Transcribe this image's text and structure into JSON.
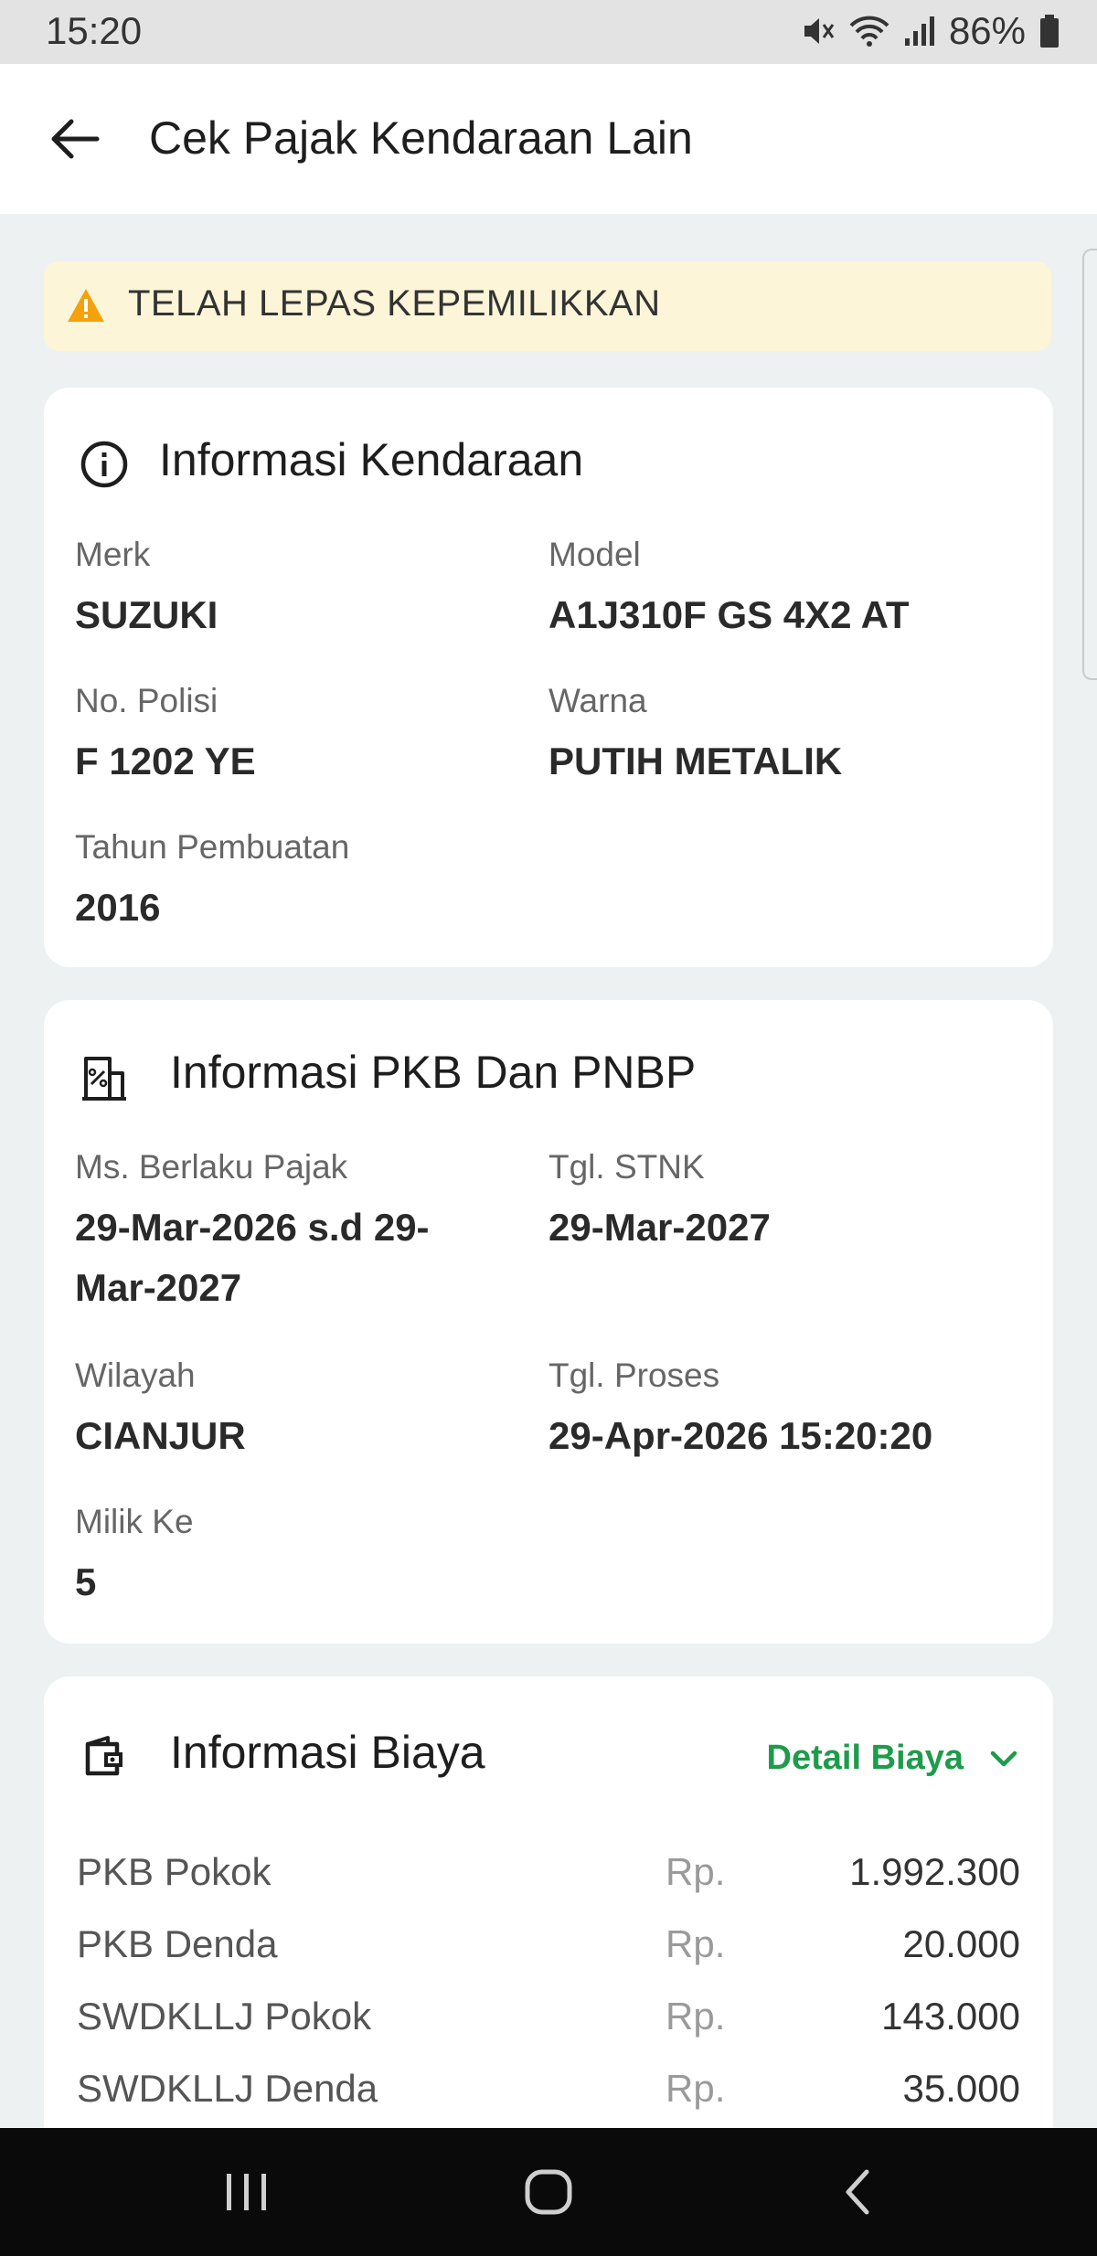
{
  "status_bar": {
    "time": "15:20",
    "battery": "86%"
  },
  "app_bar": {
    "title": "Cek Pajak Kendaraan Lain"
  },
  "alert": {
    "text": "TELAH LEPAS KEPEMILIKKAN",
    "color": "#fdf5d8",
    "icon": "warning-icon"
  },
  "vehicle_card": {
    "title": "Informasi Kendaraan",
    "icon": "info-icon",
    "fields": [
      {
        "label": "Merk",
        "value": "SUZUKI"
      },
      {
        "label": "Model",
        "value": "A1J310F GS 4X2 AT"
      },
      {
        "label": "No. Polisi",
        "value": "F 1202 YE"
      },
      {
        "label": "Warna",
        "value": "PUTIH METALIK"
      },
      {
        "label": "Tahun Pembuatan",
        "value": "2016"
      }
    ]
  },
  "pkb_card": {
    "title": "Informasi PKB Dan PNBP",
    "icon": "tax-building-icon",
    "fields": [
      {
        "label": "Ms. Berlaku Pajak",
        "value_line1": "29-Mar-2026 s.d 29-",
        "value_line2": "Mar-2027"
      },
      {
        "label": "Tgl. STNK",
        "value": "29-Mar-2027"
      },
      {
        "label": "Wilayah",
        "value": "CIANJUR"
      },
      {
        "label": "Tgl. Proses",
        "value": "29-Apr-2026 15:20:20"
      },
      {
        "label": "Milik Ke",
        "value": "5"
      }
    ]
  },
  "fee_card": {
    "title": "Informasi Biaya",
    "icon": "wallet-icon",
    "detail_link": "Detail Biaya",
    "accent": "#1e9b4b",
    "currency": "Rp.",
    "rows": [
      {
        "label": "PKB Pokok",
        "amount": "1.992.300"
      },
      {
        "label": "PKB Denda",
        "amount": "20.000"
      },
      {
        "label": "SWDKLLJ Pokok",
        "amount": "143.000"
      },
      {
        "label": "SWDKLLJ Denda",
        "amount": "35.000"
      }
    ]
  }
}
